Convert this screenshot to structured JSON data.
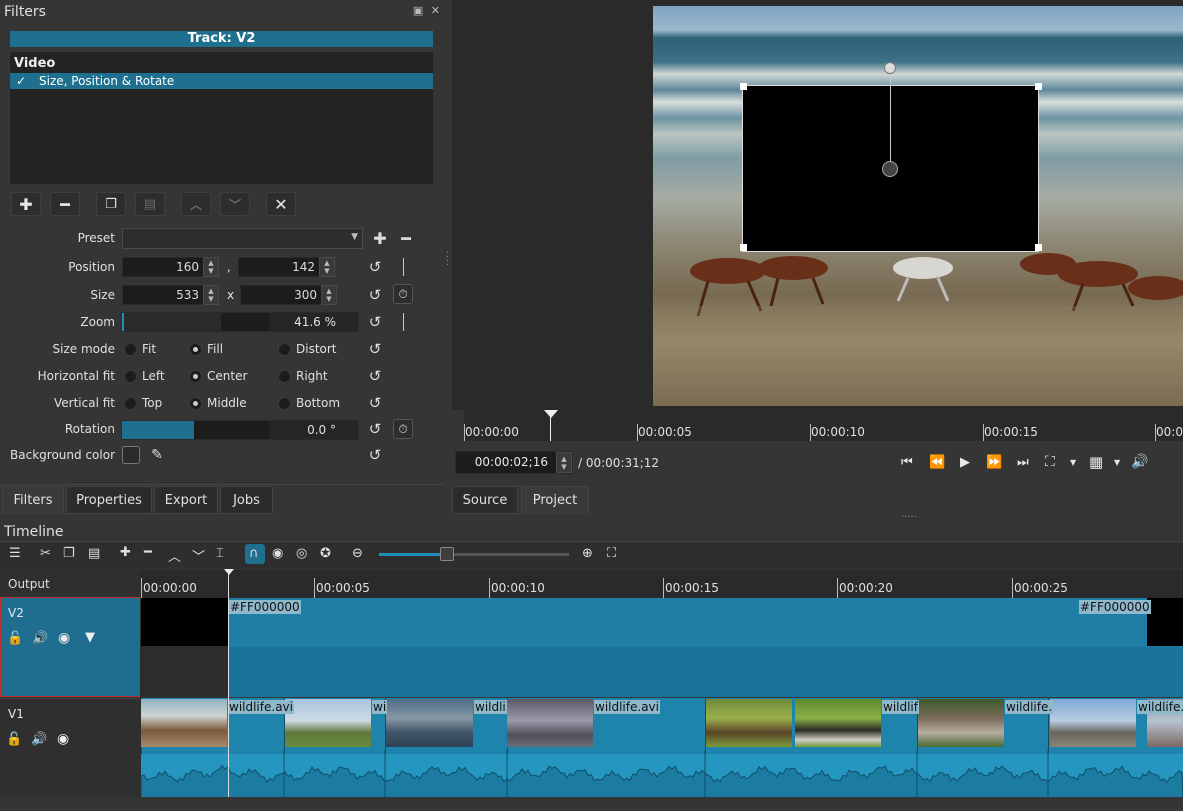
{
  "filters": {
    "title": "Filters",
    "track_label": "Track: V2",
    "category": "Video",
    "filter_items": [
      {
        "check": "✓",
        "label": "Size, Position & Rotate"
      }
    ],
    "toolbar_icons": [
      "add-icon",
      "remove-icon",
      "copy-icon",
      "paste-icon",
      "move-up-icon",
      "move-down-icon",
      "deselect-icon"
    ]
  },
  "params": {
    "preset_label": "Preset",
    "position_label": "Position",
    "position_x": "160",
    "position_sep": ",",
    "position_y": "142",
    "size_label": "Size",
    "size_w": "533",
    "size_sep": "x",
    "size_h": "300",
    "zoom_label": "Zoom",
    "zoom_value": "41.6 %",
    "zoom_fraction": 0.416,
    "size_mode_label": "Size mode",
    "size_mode_options": [
      "Fit",
      "Fill",
      "Distort"
    ],
    "size_mode_selected": "Fill",
    "hfit_label": "Horizontal fit",
    "hfit_options": [
      "Left",
      "Center",
      "Right"
    ],
    "hfit_selected": "Center",
    "vfit_label": "Vertical fit",
    "vfit_options": [
      "Top",
      "Middle",
      "Bottom"
    ],
    "vfit_selected": "Middle",
    "rotation_label": "Rotation",
    "rotation_value": "0.0 °",
    "bgcolor_label": "Background color"
  },
  "left_tabs": [
    "Filters",
    "Properties",
    "Export",
    "Jobs"
  ],
  "left_tab_active": "Filters",
  "player": {
    "ruler_labels": [
      "00:00:00",
      "00:00:05",
      "00:00:10",
      "00:00:15",
      "00:0"
    ],
    "timecode": "00:00:02;16",
    "total": "/ 00:00:31;12",
    "tabs": [
      "Source",
      "Project"
    ],
    "tab_active": "Project",
    "controls": [
      "skip-start-icon",
      "rewind-icon",
      "play-icon",
      "fast-forward-icon",
      "skip-end-icon",
      "zoom-icon",
      "grid-icon",
      "volume-icon"
    ]
  },
  "timeline": {
    "title": "Timeline",
    "output_label": "Output",
    "ruler_labels": [
      "00:00:00",
      "00:00:05",
      "00:00:10",
      "00:00:15",
      "00:00:20",
      "00:00:25"
    ],
    "tracks": [
      {
        "name": "V2",
        "icons": [
          "lock-icon",
          "audio-icon",
          "eye-icon",
          "filter-icon"
        ]
      },
      {
        "name": "V1",
        "icons": [
          "lock-icon",
          "audio-icon",
          "eye-icon"
        ]
      }
    ],
    "v2_clip_labels": [
      "#FF000000",
      "#FF000000"
    ],
    "v1_clip_labels": [
      "wildlife.avi",
      "wi",
      "wildli",
      "wildlife.avi",
      "wildlif",
      "wildlife.",
      "wildlife.a"
    ],
    "zoom_level": 0.36
  },
  "colors": {
    "accent": "#1f6f8f",
    "clip": "#1f7ea6",
    "selected_border": "#c12f2f"
  }
}
